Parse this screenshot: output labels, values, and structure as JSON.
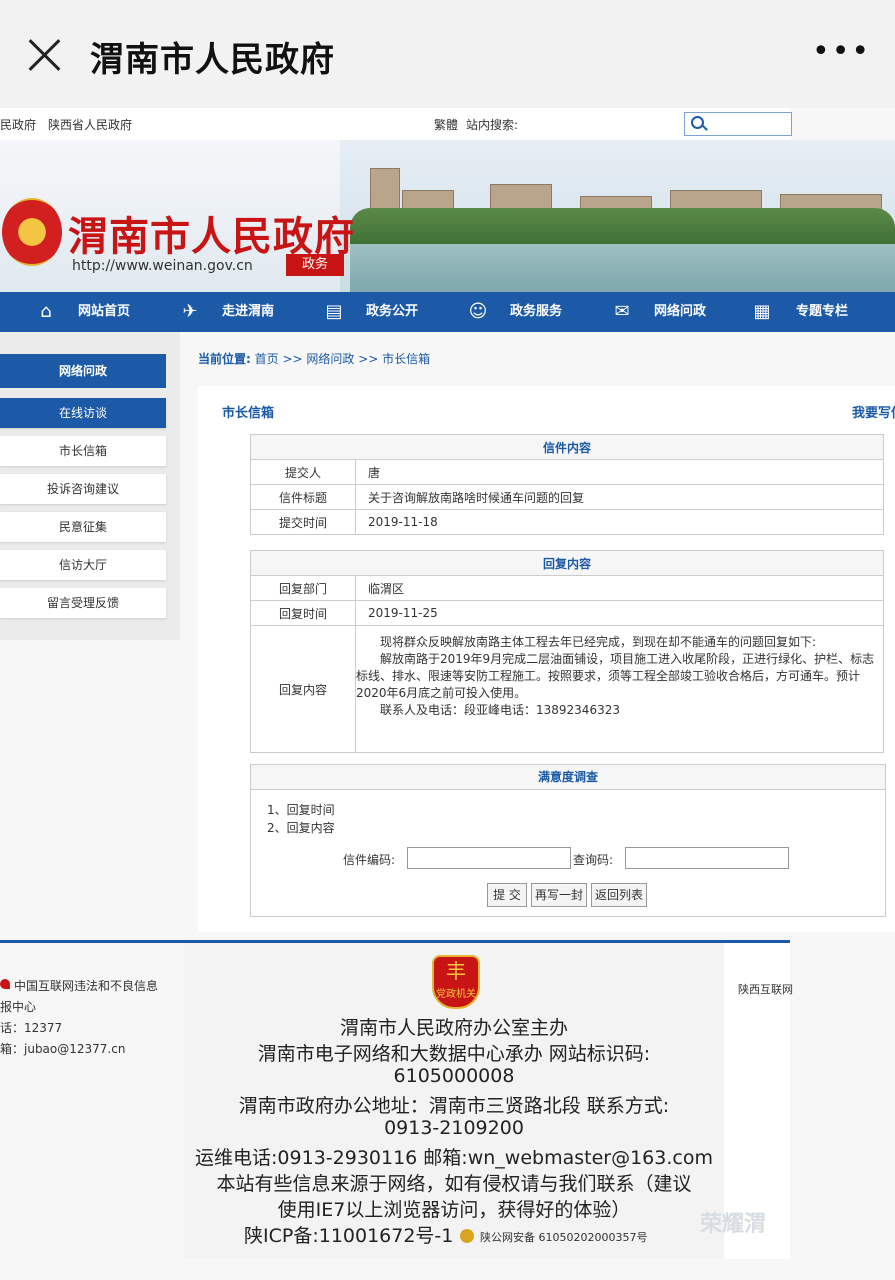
{
  "app_bar": {
    "title": "渭南市人民政府",
    "more": "•••"
  },
  "top_links": {
    "left1": "民政府",
    "left2": "陕西省人民政府",
    "traditional": "繁體",
    "search_label": "站内搜索:"
  },
  "banner": {
    "site_name": "渭南市人民政府",
    "url": "http://www.weinan.gov.cn",
    "badge": "政务"
  },
  "nav": {
    "items": [
      "网站首页",
      "走进渭南",
      "政务公开",
      "政务服务",
      "网络问政",
      "专题专栏"
    ]
  },
  "sidebar": {
    "heading": "网络问政",
    "items": [
      "在线访谈",
      "市长信箱",
      "投诉咨询建议",
      "民意征集",
      "信访大厅",
      "留言受理反馈"
    ]
  },
  "breadcrumb": {
    "label": "当前位置:",
    "trail": "首页 >> 网络问政 >> 市长信箱"
  },
  "mailbox": {
    "title": "市长信箱",
    "write_link": "我要写信"
  },
  "letter": {
    "heading": "信件内容",
    "rows": [
      {
        "label": "提交人",
        "value": "唐"
      },
      {
        "label": "信件标题",
        "value": "关于咨询解放南路啥时候通车问题的回复"
      },
      {
        "label": "提交时间",
        "value": "2019-11-18"
      }
    ]
  },
  "reply": {
    "heading": "回复内容",
    "dept_label": "回复部门",
    "dept": "临渭区",
    "time_label": "回复时间",
    "time": "2019-11-25",
    "content_label": "回复内容",
    "p1": "现将群众反映解放南路主体工程去年已经完成，到现在却不能通车的问题回复如下:",
    "p2": "解放南路于2019年9月完成二层油面铺设，项目施工进入收尾阶段，正进行绿化、护栏、标志标线、排水、限速等安防工程施工。按照要求，须等工程全部竣工验收合格后，方可通车。预计2020年6月底之前可投入使用。",
    "p3": "联系人及电话：段亚峰电话：13892346323"
  },
  "survey": {
    "heading": "满意度调查",
    "items": [
      "1、回复时间",
      "2、回复内容"
    ],
    "code_label": "信件编码:",
    "query_label": "查询码:",
    "buttons": [
      "提 交",
      "再写一封",
      "返回列表"
    ]
  },
  "footer": {
    "left": [
      "中国互联网违法和不良信息",
      "报中心",
      "话：12377",
      "箱：jubao@12377.cn"
    ],
    "shield_text": "党政机关",
    "lines": [
      "渭南市人民政府办公室主办",
      "渭南市电子网络和大数据中心承办 网站标识码:",
      "6105000008",
      "渭南市政府办公地址：渭南市三贤路北段 联系方式:",
      "0913-2109200",
      "运维电话:0913-2930116 邮箱:wn_webmaster@163.com",
      "本站有些信息来源于网络，如有侵权请与我们联系（建议",
      "使用IE7以上浏览器访问，获得好的体验）",
      "陕ICP备:11001672号-1"
    ],
    "police": "陕公网安备 61050202000357号",
    "right": "陕西互联网",
    "watermark": "荣耀渭"
  },
  "colors": {
    "primary": "#1c5aa8",
    "brand_red": "#c81414"
  }
}
